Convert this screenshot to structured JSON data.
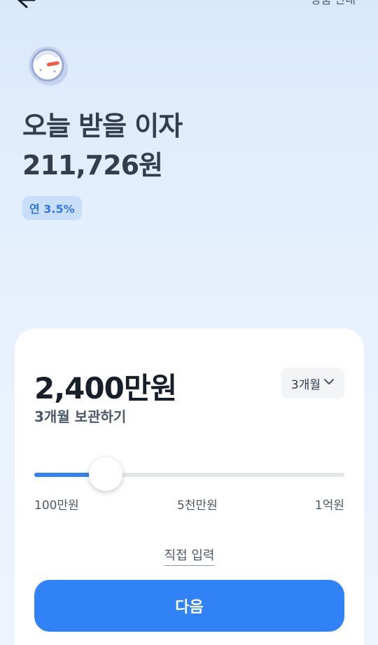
{
  "header": {
    "product_guide_label": "상품 안내"
  },
  "hero": {
    "title_line1": "오늘 받을 이자",
    "title_line2": "211,726원",
    "rate_badge": "연 3.5%"
  },
  "deposit": {
    "amount": "2,400만원",
    "subtitle": "3개월 보관하기",
    "period_selected": "3개월",
    "slider": {
      "min_label": "100만원",
      "mid_label": "5천만원",
      "max_label": "1억원",
      "fill_fraction": 0.23
    },
    "direct_input_label": "직접 입력",
    "next_button_label": "다음"
  },
  "colors": {
    "accent": "#3182f6",
    "badge_bg": "#c9def9",
    "badge_text": "#3478e0"
  },
  "icons": [
    "back-arrow-icon",
    "meter-gauge-icon",
    "chevron-down-icon"
  ]
}
